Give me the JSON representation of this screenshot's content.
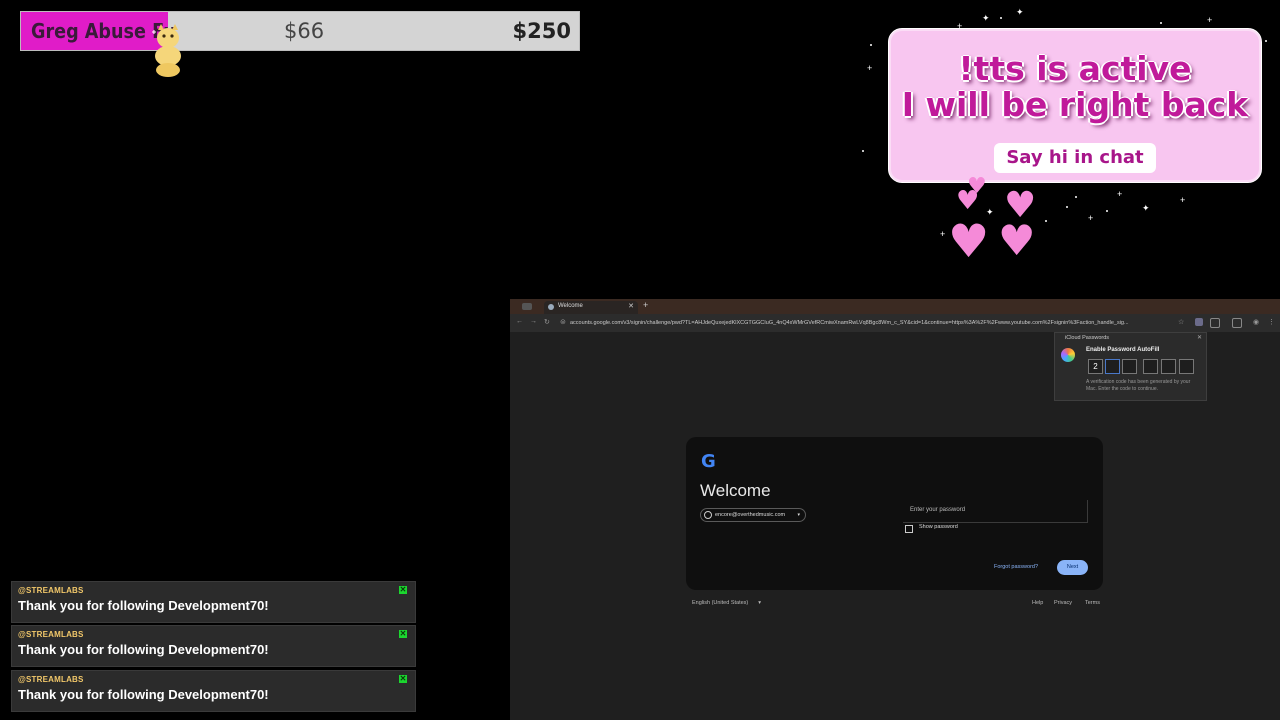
{
  "goal": {
    "title": "Greg Abuse Fu",
    "current": "$66",
    "target": "$250",
    "progress_fraction": 0.264,
    "fill_color": "#e01cc8"
  },
  "brb": {
    "line1": "!tts is active",
    "line2": "I will be right back",
    "chip": "Say hi in chat"
  },
  "alerts": [
    {
      "source": "@STREAMLABS",
      "message": "Thank you for following Development70!"
    },
    {
      "source": "@STREAMLABS",
      "message": "Thank you for following Development70!"
    },
    {
      "source": "@STREAMLABS",
      "message": "Thank you for following Development70!"
    }
  ],
  "browser": {
    "tab_title": "Welcome",
    "url": "accounts.google.com/v3/signin/challenge/pwd?TL=AHJdeQuxejedKlXCGTGGCIuG_4nQ4xWMrGVefRCmiwXnamRwLVq8Bgc8Wm_c_SY&cid=1&continue=https%3A%2F%2Fwww.youtube.com%2Fsignin%3Faction_handle_sig...",
    "icloud": {
      "header": "iCloud Passwords",
      "title": "Enable Password AutoFill",
      "code_digits": [
        "2",
        "",
        "",
        "",
        "",
        ""
      ],
      "note": "A verification code has been generated by your Mac. Enter the code to continue."
    },
    "signin": {
      "logo": "G",
      "heading": "Welcome",
      "account": "encore@overthedmusic.com",
      "password_placeholder": "Enter your password",
      "show_password": "Show password",
      "forgot": "Forgot password?",
      "next": "Next"
    },
    "footer": {
      "language": "English (United States)",
      "help": "Help",
      "privacy": "Privacy",
      "terms": "Terms"
    }
  }
}
